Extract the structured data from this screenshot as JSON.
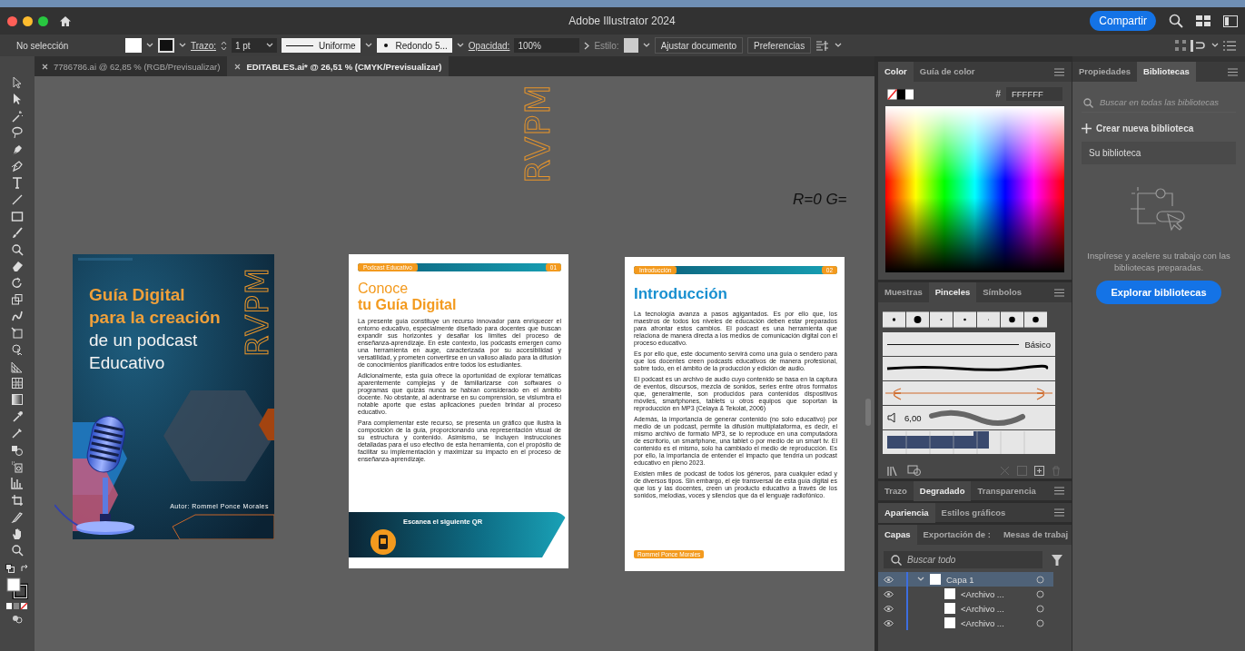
{
  "window": {
    "title": "Adobe Illustrator 2024",
    "share_button": "Compartir"
  },
  "control_bar": {
    "selection": "No selección",
    "stroke_label": "Trazo:",
    "stroke_value": "1 pt",
    "profile": "Uniforme",
    "brush": "Redondo 5...",
    "opacity_label": "Opacidad:",
    "opacity_value": "100%",
    "style_label": "Estilo:",
    "buttons": [
      "Ajustar documento",
      "Preferencias"
    ]
  },
  "doc_tabs": [
    {
      "label": "7786786.ai @ 62,85 % (RGB/Previsualizar)",
      "selected": false
    },
    {
      "label": "EDITABLES.ai* @ 26,51 % (CMYK/Previsualizar)",
      "selected": true
    }
  ],
  "canvas": {
    "logo_text": "RVPM",
    "stray_text": "R=0 G=",
    "cover": {
      "title_lines": [
        "Guía Digital",
        "para la creación"
      ],
      "subtitle_lines": [
        "de un podcast",
        "Educativo"
      ],
      "logo_text": "RVPM",
      "author": "Autor: Rommel Ponce Morales"
    },
    "page_1": {
      "header_label": "Podcast Educativo",
      "page_number": "01",
      "title_light": "Conoce",
      "title_bold": "tu Guía Digital",
      "paragraphs": [
        "La presente guía constituye un recurso innovador para enriquecer el entorno educativo, especialmente diseñado para docentes que buscan expandir sus horizontes y desafiar los límites del proceso de enseñanza-aprendizaje. En este contexto, los podcasts emergen como una herramienta en auge, caracterizada por su accesibilidad y versatilidad, y prometen convertirse en un valioso aliado para la difusión de conocimientos planificados entre todos los estudiantes.",
        "Adicionalmente, esta guía ofrece la oportunidad de explorar temáticas aparentemente complejas y de familiarizarse con softwares o programas que quizás nunca se habían considerado en el ámbito docente. No obstante, al adentrarse en su comprensión, se vislumbra el notable aporte que estas aplicaciones pueden brindar al proceso educativo.",
        "Para complementar este recurso, se presenta un gráfico que ilustra la composición de la guía, proporcionando una representación visual de su estructura y contenido. Asimismo, se incluyen instrucciones detalladas para el uso efectivo de esta herramienta, con el propósito de facilitar su implementación y maximizar su impacto en el proceso de enseñanza-aprendizaje."
      ],
      "banner_text": "Escanea el siguiente QR"
    },
    "page_2": {
      "header_label": "Introducción",
      "page_number": "02",
      "title": "Introducción",
      "paragraphs": [
        "La tecnología avanza a pasos agigantados. Es por ello que, los maestros de todos los niveles de educación deben estar preparados para afrontar estos cambios. El podcast es una herramienta que relaciona de manera directa a los medios de comunicación digital con el proceso educativo.",
        "Es por ello que, este documento servirá como una guía o sendero para que los docentes creen podcasts educativos de manera profesional, sobre todo, en el ámbito de la producción y edición de audio.",
        "El podcast es un archivo de audio cuyo contenido se basa en la captura de eventos, discursos, mezcla de sonidos, series entre otros formatos que, generalmente, son producidos para contenidos dispositivos móviles, smartphones, tablets u otros equipos que soportan la reproducción en MP3 (Celaya & Tekolat, 2006)",
        "Además, la importancia de generar contenido (no solo educativo) por medio de un podcast, permite la difusión multiplataforma, es decir, el mismo archivo de formato MP3, se lo reproduce en una computadora de escritorio, un smartphone, una tablet o por medio de un smart tv. El contenido es el mismo, solo ha cambiado el medio de reproducción. Es por ello, la importancia de entender el impacto que tendría un podcast educativo en pleno 2023.",
        "Existen miles de podcast de todos los géneros, para cualquier edad y de diversos tipos. Sin embargo, el eje transversal de esta guía digital es que los y las docentes, creen un producto educativo a través de los sonidos, melodías, voces y silencios que da el lenguaje radiofónico."
      ],
      "footer_tag": "Rommel Ponce Morales"
    }
  },
  "color_panel": {
    "tabs": [
      {
        "label": "Color",
        "selected": true
      },
      {
        "label": "Guía de color",
        "selected": false
      }
    ],
    "hex_label": "#",
    "hex_value": "FFFFFF"
  },
  "brushes_panel": {
    "tabs": [
      {
        "label": "Muestras",
        "selected": false
      },
      {
        "label": "Pinceles",
        "selected": true
      },
      {
        "label": "Símbolos",
        "selected": false
      }
    ],
    "basic_label": "Básico",
    "size_value": "6,00"
  },
  "gradient_panel": {
    "tabs": [
      {
        "label": "Trazo",
        "selected": false
      },
      {
        "label": "Degradado",
        "selected": true
      },
      {
        "label": "Transparencia",
        "selected": false
      }
    ]
  },
  "appearance_panel": {
    "tabs": [
      {
        "label": "Apariencia",
        "selected": true
      },
      {
        "label": "Estilos gráficos",
        "selected": false
      }
    ]
  },
  "layers_panel": {
    "tabs": [
      {
        "label": "Capas",
        "selected": true
      },
      {
        "label": "Exportación de :",
        "selected": false
      },
      {
        "label": "Mesas de trabaj",
        "selected": false
      }
    ],
    "search_placeholder": "Buscar todo",
    "layers": [
      {
        "name": "Capa 1",
        "expanded": true,
        "selected": true,
        "children": [
          {
            "name": "<Archivo ...",
            "selected": false
          },
          {
            "name": "<Archivo ...",
            "selected": false
          },
          {
            "name": "<Archivo ...",
            "selected": false
          }
        ]
      }
    ]
  },
  "libraries_panel": {
    "tabs": [
      {
        "label": "Propiedades",
        "selected": false
      },
      {
        "label": "Bibliotecas",
        "selected": true
      }
    ],
    "search_placeholder": "Buscar en todas las bibliotecas",
    "create_label": "Crear nueva biblioteca",
    "library": "Su biblioteca",
    "promo": "Inspírese y acelere su trabajo con las bibliotecas preparadas.",
    "explore_button": "Explorar bibliotecas"
  }
}
